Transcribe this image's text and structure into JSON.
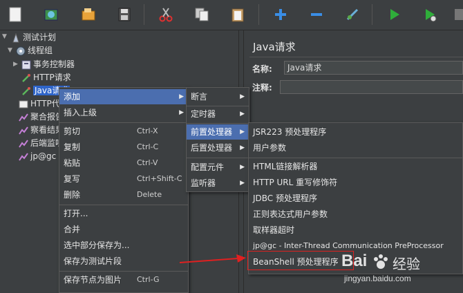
{
  "toolbar": {
    "buttons": [
      {
        "icon": "new-file-icon"
      },
      {
        "icon": "templates-icon"
      },
      {
        "icon": "open-folder-icon"
      },
      {
        "icon": "save-icon"
      },
      {
        "icon": "cut-icon"
      },
      {
        "icon": "copy-icon"
      },
      {
        "icon": "paste-icon"
      },
      {
        "icon": "expand-icon"
      },
      {
        "icon": "collapse-icon"
      },
      {
        "icon": "toggle-icon"
      },
      {
        "icon": "start-icon"
      },
      {
        "icon": "start-no-pause-icon"
      },
      {
        "icon": "stop-icon"
      }
    ]
  },
  "tree": {
    "items": [
      {
        "label": "测试计划",
        "icon": "test-plan-icon"
      },
      {
        "label": "线程组",
        "icon": "thread-group-icon"
      },
      {
        "label": "事务控制器",
        "icon": "controller-icon"
      },
      {
        "label": "HTTP请求",
        "icon": "sampler-icon"
      },
      {
        "label": "Java请求",
        "icon": "sampler-icon"
      },
      {
        "label": "HTTP代",
        "icon": "config-icon"
      },
      {
        "label": "聚合报告",
        "icon": "listener-icon"
      },
      {
        "label": "察看结果",
        "icon": "listener-icon"
      },
      {
        "label": "后端监听",
        "icon": "listener-icon"
      },
      {
        "label": "jp@gc -",
        "icon": "listener-icon"
      }
    ]
  },
  "panel": {
    "title": "Java请求",
    "name_label": "名称:",
    "name_value": "Java请求",
    "comment_label": "注释:"
  },
  "context_menu": {
    "items": [
      {
        "label": "添加",
        "shortcut": "",
        "submenu": true
      },
      {
        "label": "插入上级",
        "shortcut": "",
        "submenu": true
      },
      {
        "label": "剪切",
        "shortcut": "Ctrl-X"
      },
      {
        "label": "复制",
        "shortcut": "Ctrl-C"
      },
      {
        "label": "粘贴",
        "shortcut": "Ctrl-V"
      },
      {
        "label": "复写",
        "shortcut": "Ctrl+Shift-C"
      },
      {
        "label": "删除",
        "shortcut": "Delete"
      },
      {
        "label": "打开..."
      },
      {
        "label": "合并"
      },
      {
        "label": "选中部分保存为..."
      },
      {
        "label": "保存为测试片段"
      },
      {
        "label": "保存节点为图片",
        "shortcut": "Ctrl-G"
      }
    ]
  },
  "add_submenu": {
    "items": [
      {
        "label": "断言"
      },
      {
        "label": "定时器"
      },
      {
        "label": "前置处理器"
      },
      {
        "label": "后置处理器"
      },
      {
        "label": "配置元件"
      },
      {
        "label": "监听器"
      }
    ]
  },
  "preprocessor_submenu": {
    "items": [
      {
        "label": "JSR223 预处理程序"
      },
      {
        "label": "用户参数"
      },
      {
        "label": "HTML链接解析器"
      },
      {
        "label": "HTTP URL 重写修饰符"
      },
      {
        "label": "JDBC 预处理程序"
      },
      {
        "label": "正则表达式用户参数"
      },
      {
        "label": "取样器超时"
      },
      {
        "label": "jp@gc - Inter-Thread Communication PreProcessor"
      },
      {
        "label": "BeanShell 预处理程序"
      }
    ]
  },
  "watermark": {
    "brand": "Bai",
    "brand_cn": "经验",
    "url": "jingyan.baidu.com"
  },
  "colors": {
    "background": "#3c3f41",
    "selection": "#4b6eaf",
    "annotation_red": "#e02020"
  }
}
